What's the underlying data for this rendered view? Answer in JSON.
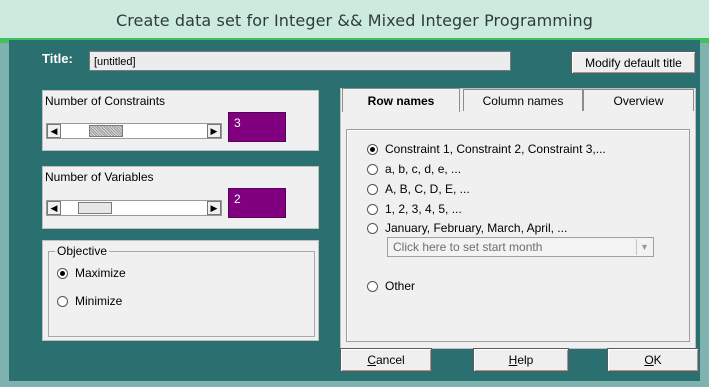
{
  "window": {
    "title": "Create data set for Integer && Mixed Integer Programming"
  },
  "title_field": {
    "label": "Title:",
    "value": "[untitled]"
  },
  "modify_title_button": "Modify default title",
  "constraints": {
    "label": "Number of Constraints",
    "value": "3",
    "slider_fraction": 0.25
  },
  "variables": {
    "label": "Number of Variables",
    "value": "2",
    "slider_fraction": 0.15
  },
  "objective": {
    "legend": "Objective",
    "options": [
      {
        "label": "Maximize",
        "selected": true
      },
      {
        "label": "Minimize",
        "selected": false
      }
    ]
  },
  "tabs": [
    {
      "label": "Row names",
      "active": true
    },
    {
      "label": "Column names",
      "active": false
    },
    {
      "label": "Overview",
      "active": false
    }
  ],
  "row_names": {
    "options": [
      {
        "label": "Constraint 1, Constraint 2, Constraint 3,...",
        "selected": true
      },
      {
        "label": "a, b, c, d, e, ...",
        "selected": false
      },
      {
        "label": "A, B, C, D, E, ...",
        "selected": false
      },
      {
        "label": "1, 2, 3, 4, 5, ...",
        "selected": false
      },
      {
        "label": "January, February, March, April, ...",
        "selected": false
      }
    ],
    "month_dropdown": "Click here to set start month",
    "other_label": "Other"
  },
  "buttons": {
    "cancel": {
      "underline": "C",
      "rest": "ancel"
    },
    "help": {
      "underline": "H",
      "rest": "elp"
    },
    "ok": {
      "underline": "O",
      "rest": "K"
    }
  },
  "colors": {
    "accent_purple": "#800080",
    "background_teal": "#2a7070",
    "titlebar": "#cdeadf"
  }
}
